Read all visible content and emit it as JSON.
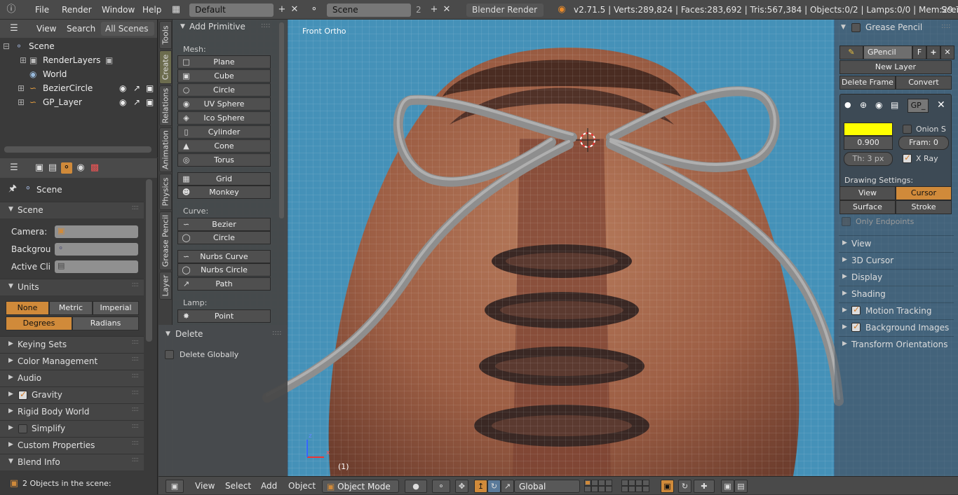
{
  "topbar": {
    "menus": [
      "File",
      "Render",
      "Window",
      "Help"
    ],
    "screen_layout": "Default",
    "scene_name": "Scene",
    "scene_users": "2",
    "render_engine": "Blender Render",
    "stats": "v2.71.5 | Verts:289,824 | Faces:283,692 | Tris:567,384 | Objects:0/2 | Lamps:0/0 | Mem:29.75M",
    "right_cut": "Scen"
  },
  "outliner": {
    "menus": [
      "View",
      "Search"
    ],
    "filter": "All Scenes",
    "rows": [
      {
        "label": "Scene"
      },
      {
        "label": "RenderLayers"
      },
      {
        "label": "World"
      },
      {
        "label": "BezierCircle"
      },
      {
        "label": "GP_Layer"
      }
    ]
  },
  "properties": {
    "context": "Scene",
    "scene_panel": {
      "title": "Scene",
      "camera_label": "Camera:",
      "background_label": "Backgrou",
      "active_clip_label": "Active Cli"
    },
    "units_panel": {
      "title": "Units",
      "systems": [
        "None",
        "Metric",
        "Imperial"
      ],
      "rotation": [
        "Degrees",
        "Radians"
      ]
    },
    "panels": [
      "Keying Sets",
      "Color Management",
      "Audio",
      "Gravity",
      "Rigid Body World",
      "Simplify",
      "Custom Properties",
      "Blend Info"
    ],
    "blend_info": "2 Objects in the scene:"
  },
  "tool_tabs": [
    "Tools",
    "Create",
    "Relations",
    "Animation",
    "Physics",
    "Grease Pencil",
    "Layer"
  ],
  "add_primitive": {
    "title": "Add Primitive",
    "mesh_label": "Mesh:",
    "mesh": [
      "Plane",
      "Cube",
      "Circle",
      "UV Sphere",
      "Ico Sphere",
      "Cylinder",
      "Cone",
      "Torus"
    ],
    "mesh_extra": [
      "Grid",
      "Monkey"
    ],
    "curve_label": "Curve:",
    "curve": [
      "Bezier",
      "Circle"
    ],
    "nurbs": [
      "Nurbs Curve",
      "Nurbs Circle",
      "Path"
    ],
    "lamp_label": "Lamp:",
    "lamp": [
      "Point"
    ]
  },
  "redo_panel": {
    "title": "Delete",
    "option": "Delete Globally"
  },
  "viewport": {
    "view_name": "Front Ortho",
    "frame": "(1)",
    "axis_x": "x",
    "axis_z": "z"
  },
  "grease_pencil": {
    "title": "Grease Pencil",
    "datablock": "GPencil",
    "fake_user": "F",
    "new_layer": "New Layer",
    "delete_frame": "Delete Frame",
    "convert": "Convert",
    "layer_name": "GP_",
    "color": "#ffff00",
    "opacity": "0.900",
    "onion": "Onion S",
    "frame": "Fram: 0",
    "thickness": "Th: 3 px",
    "xray": "X Ray",
    "drawing_settings": "Drawing Settings:",
    "draw_modes": [
      "View",
      "Cursor",
      "Surface",
      "Stroke"
    ],
    "only_endpoints": "Only Endpoints"
  },
  "npanels": [
    "View",
    "3D Cursor",
    "Display",
    "Shading",
    "Motion Tracking",
    "Background Images",
    "Transform Orientations"
  ],
  "bottombar": {
    "menus": [
      "View",
      "Select",
      "Add",
      "Object"
    ],
    "mode": "Object Mode",
    "orientation": "Global"
  },
  "colors": {
    "accent": "#d08a3a",
    "viewport_bg": "#3c6f92",
    "header": "#4a4a4a"
  }
}
